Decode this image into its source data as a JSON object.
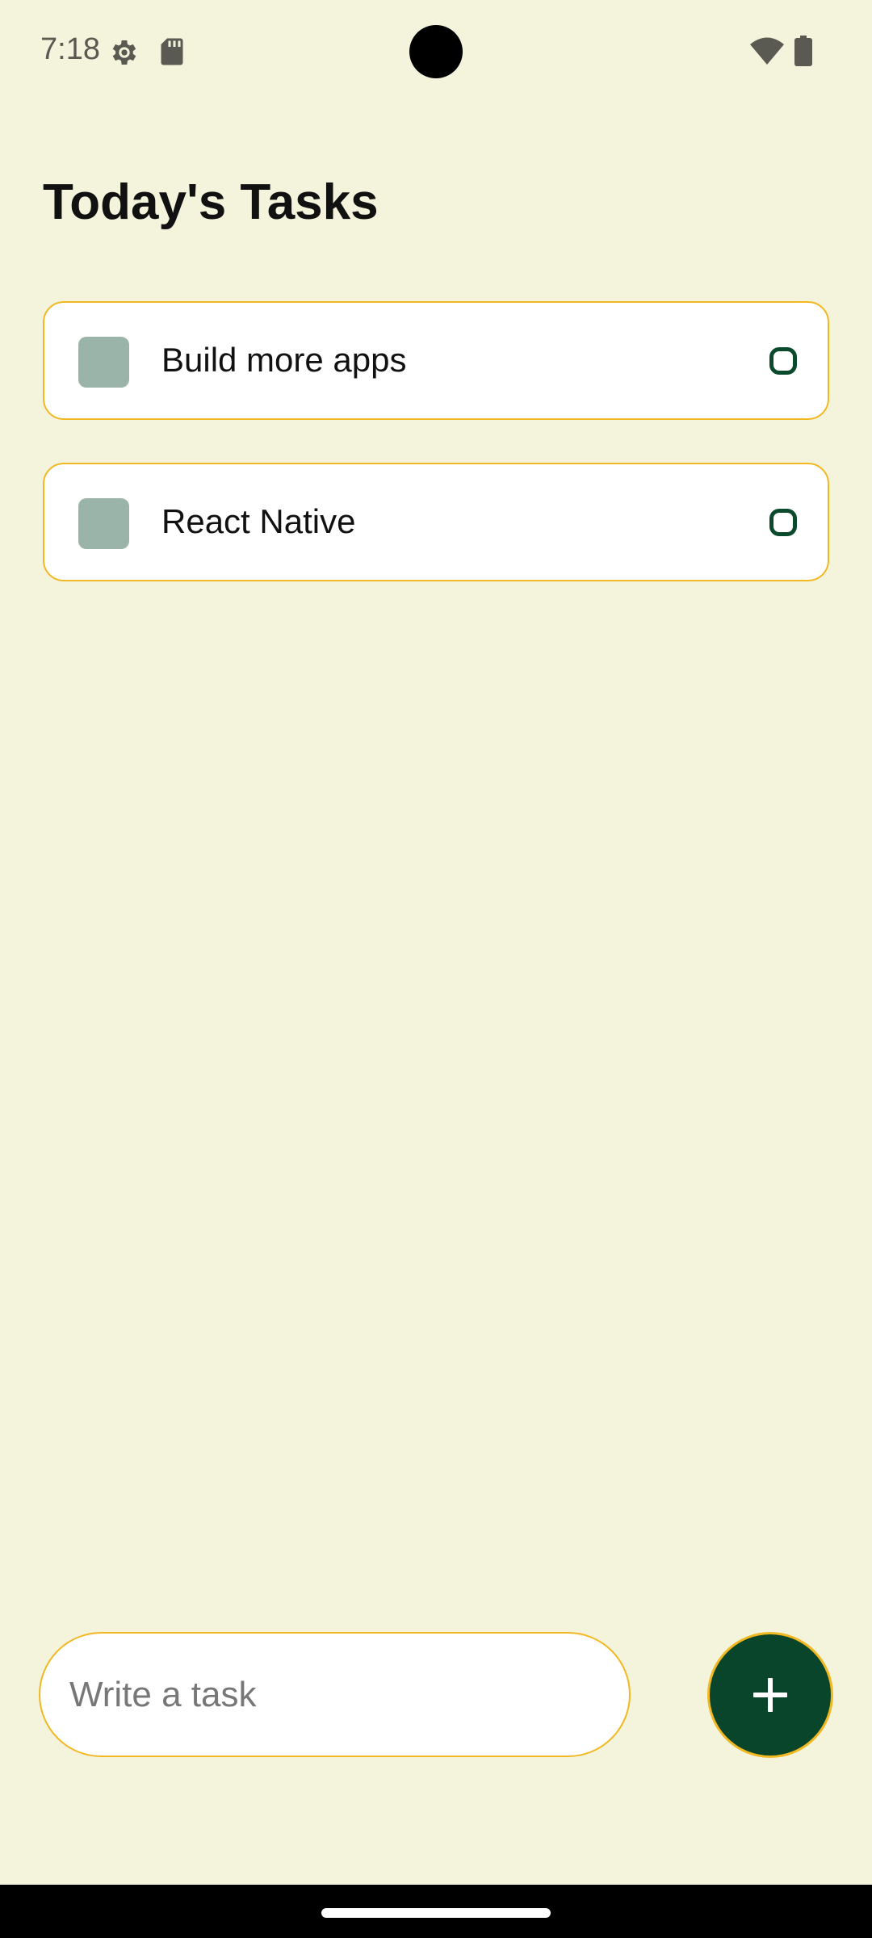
{
  "status_bar": {
    "time": "7:18",
    "icons": [
      "settings-gear-icon",
      "sd-card-icon",
      "wifi-icon",
      "battery-icon"
    ]
  },
  "page": {
    "title": "Today's Tasks"
  },
  "tasks": [
    {
      "label": "Build more apps"
    },
    {
      "label": "React Native"
    }
  ],
  "input": {
    "placeholder": "Write a task",
    "value": ""
  },
  "add_button": {
    "icon": "plus-icon"
  },
  "colors": {
    "background": "#F4F4DC",
    "accent_border": "#F2B821",
    "primary_green": "#08452A",
    "task_square": "#9AB4AA"
  }
}
